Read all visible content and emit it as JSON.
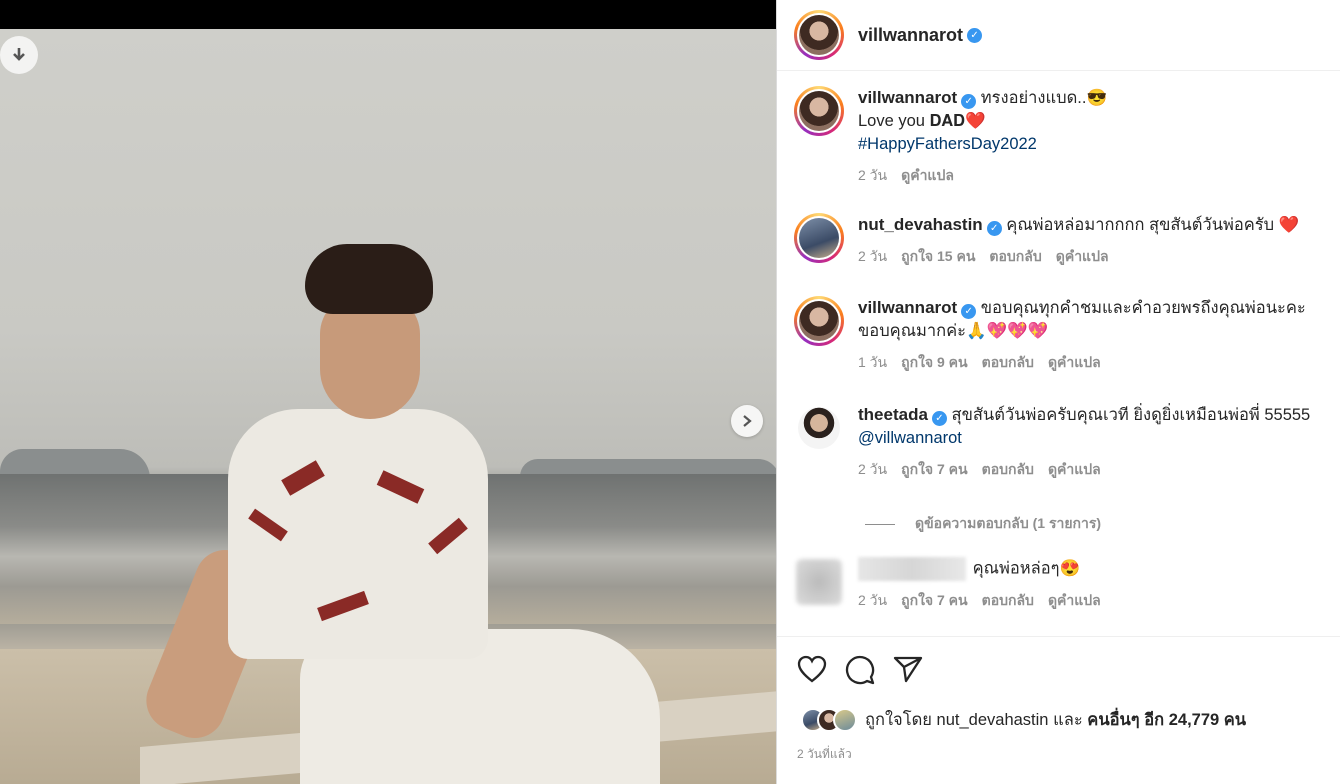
{
  "post": {
    "author": "villwannarot",
    "verified": true
  },
  "comments": [
    {
      "user": "villwannarot",
      "text_line1": "ทรงอย่างแบด..😎",
      "text_line2": "Love you 𝐃𝐀𝐃❤️",
      "hashtag": "#HappyFathersDay2022",
      "time": "2 วัน",
      "likes": "",
      "reply": "",
      "translate": "ดูคำแปล"
    },
    {
      "user": "nut_devahastin",
      "text_line1": "คุณพ่อหล่อมากกกก สุขสันต์วันพ่อครับ ❤️",
      "time": "2 วัน",
      "likes": "ถูกใจ 15 คน",
      "reply": "ตอบกลับ",
      "translate": "ดูคำแปล"
    },
    {
      "user": "villwannarot",
      "text_line1": "ขอบคุณทุกคำชมและคำอวยพรถึงคุณพ่อนะคะ",
      "text_line2": "ขอบคุณมากค่ะ🙏💖💖💖",
      "time": "1 วัน",
      "likes": "ถูกใจ 9 คน",
      "reply": "ตอบกลับ",
      "translate": "ดูคำแปล"
    },
    {
      "user": "theetada",
      "text_line1": "สุขสันต์วันพ่อครับคุณเวที ยิ่งดูยิ่งเหมือนพ่อพี่ 55555",
      "mention": "@villwannarot",
      "time": "2 วัน",
      "likes": "ถูกใจ 7 คน",
      "reply": "ตอบกลับ",
      "translate": "ดูคำแปล"
    },
    {
      "user": "",
      "text_line1": "คุณพ่อหล่อๆ😍",
      "time": "2 วัน",
      "likes": "ถูกใจ 7 คน",
      "reply": "ตอบกลับ",
      "translate": "ดูคำแปล"
    }
  ],
  "view_replies": "ดูข้อความตอบกลับ (1 รายการ)",
  "footer": {
    "liked_by_prefix": "ถูกใจโดย",
    "liked_by_user": "nut_devahastin",
    "liked_by_and": "และ",
    "liked_by_others": "คนอื่นๆ อีก 24,779 คน",
    "time_ago": "2 วันที่แล้ว"
  },
  "icons": {
    "download": "download-icon",
    "next": "chevron-right-icon",
    "like": "heart-icon",
    "comment": "comment-icon",
    "share": "share-icon",
    "verified": "verified-badge-icon"
  },
  "colors": {
    "verified": "#3897f0",
    "link": "#00376b",
    "secondary_text": "#8e8e8e"
  }
}
